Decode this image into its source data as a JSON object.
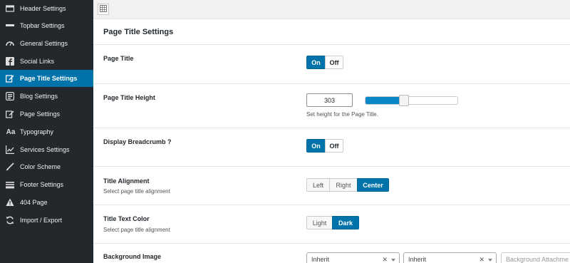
{
  "sidebar": {
    "items": [
      {
        "label": "Header Settings",
        "icon": "header-icon",
        "active": false
      },
      {
        "label": "Topbar Settings",
        "icon": "topbar-icon",
        "active": false
      },
      {
        "label": "General Settings",
        "icon": "dashboard-icon",
        "active": false
      },
      {
        "label": "Social Links",
        "icon": "facebook-icon",
        "active": false
      },
      {
        "label": "Page Title Settings",
        "icon": "edit-icon",
        "active": true
      },
      {
        "label": "Blog Settings",
        "icon": "blog-icon",
        "active": false
      },
      {
        "label": "Page Settings",
        "icon": "page-edit-icon",
        "active": false
      },
      {
        "label": "Typography",
        "icon": "typography-icon",
        "active": false
      },
      {
        "label": "Services Settings",
        "icon": "chart-icon",
        "active": false
      },
      {
        "label": "Color Scheme",
        "icon": "brush-icon",
        "active": false
      },
      {
        "label": "Footer Settings",
        "icon": "footer-icon",
        "active": false
      },
      {
        "label": "404 Page",
        "icon": "warning-icon",
        "active": false
      },
      {
        "label": "Import / Export",
        "icon": "refresh-icon",
        "active": false
      }
    ]
  },
  "panel": {
    "title": "Page Title Settings"
  },
  "fields": {
    "page_title": {
      "label": "Page Title",
      "on": "On",
      "off": "Off",
      "value": "On"
    },
    "page_title_height": {
      "label": "Page Title Height",
      "value": "303",
      "description": "Set height for the Page Title.",
      "slider_fraction": 0.42
    },
    "display_breadcrumb": {
      "label": "Display Breadcrumb ?",
      "on": "On",
      "off": "Off",
      "value": "On"
    },
    "title_alignment": {
      "label": "Title Alignment",
      "description": "Select page title alignment",
      "options": [
        "Left",
        "Right",
        "Center"
      ],
      "value": "Center"
    },
    "title_text_color": {
      "label": "Title Text Color",
      "description": "Select page title alignment",
      "options": [
        "Light",
        "Dark"
      ],
      "value": "Dark"
    },
    "background_image": {
      "label": "Background Image",
      "select1": "Inherit",
      "select2": "Inherit",
      "select3_placeholder": "Background Attachme"
    }
  },
  "colors": {
    "sidebar_bg": "#23282d",
    "accent": "#0073aa"
  }
}
